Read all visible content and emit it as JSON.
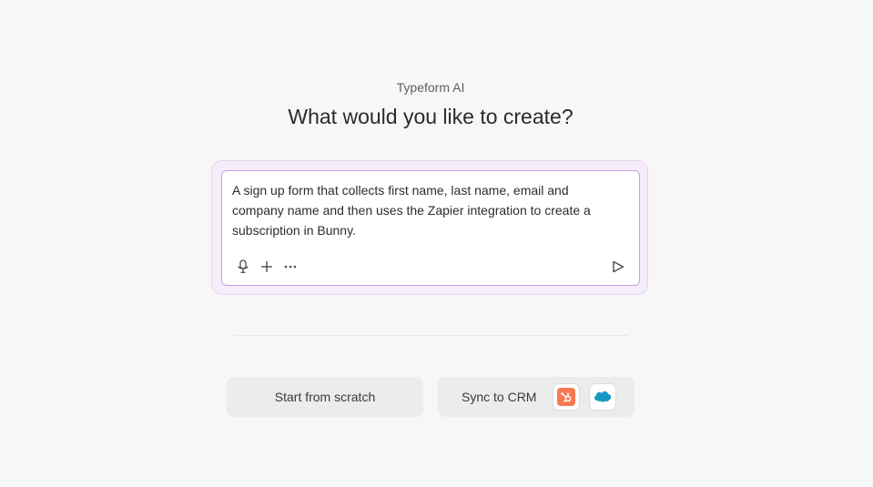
{
  "header": {
    "eyebrow": "Typeform AI",
    "title": "What would you like to create?"
  },
  "prompt": {
    "value": "A sign up form that collects first name, last name, email and company name and then uses the Zapier integration to create a subscription in Bunny.",
    "tools": [
      "microphone-icon",
      "plus-icon",
      "more-icon"
    ],
    "send_icon": "send-icon"
  },
  "actions": {
    "start_label": "Start from scratch",
    "crm_label": "Sync to CRM",
    "crm_logos": [
      "hubspot-logo",
      "salesforce-logo"
    ]
  },
  "colors": {
    "background": "#f7f7f7",
    "prompt_glow": "#f6edfb",
    "prompt_border": "#c99be0",
    "hubspot": "#f57a52",
    "salesforce": "#1798c1"
  }
}
